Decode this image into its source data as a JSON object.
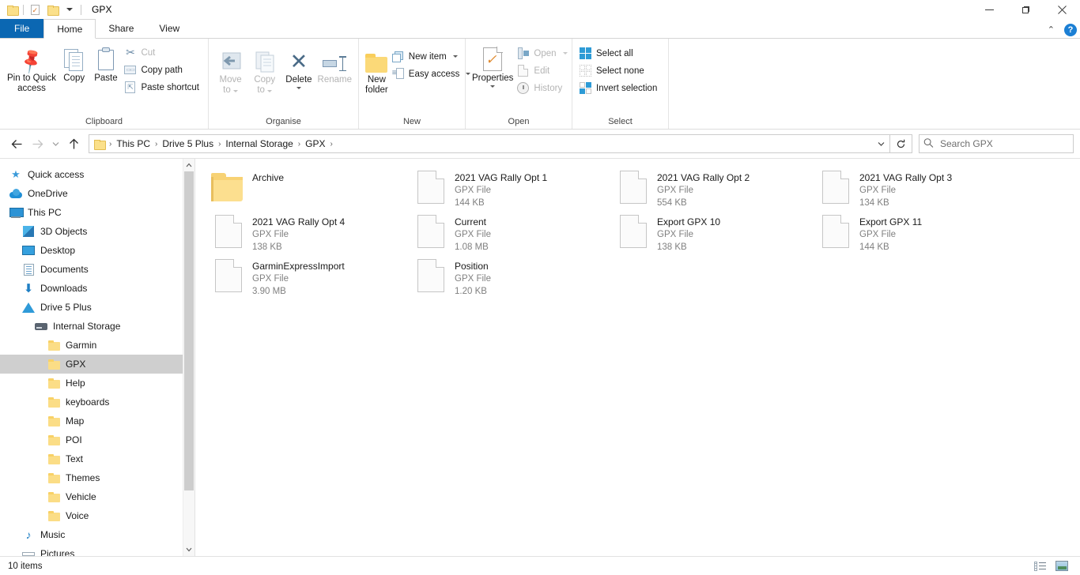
{
  "window": {
    "title": "GPX",
    "quick_access": [
      "folder-icon",
      "properties-icon",
      "new-folder-icon",
      "dropdown-arrow-icon"
    ],
    "controls": {
      "minimize": "—",
      "maximize": "❐",
      "close": "✕"
    }
  },
  "tabs": [
    {
      "id": "file",
      "label": "File"
    },
    {
      "id": "home",
      "label": "Home"
    },
    {
      "id": "share",
      "label": "Share"
    },
    {
      "id": "view",
      "label": "View"
    }
  ],
  "tab_right": {
    "collapse": "⌃",
    "help": "?"
  },
  "ribbon": {
    "groups": [
      {
        "name": "Clipboard",
        "label": "Clipboard",
        "big_buttons": [
          {
            "name": "pin-to-quick-access",
            "label": "Pin to Quick\naccess",
            "line1": "Pin to Quick",
            "line2": "access",
            "disabled": false
          },
          {
            "name": "copy",
            "label": "Copy",
            "line1": "Copy",
            "line2": "",
            "disabled": false
          },
          {
            "name": "paste",
            "label": "Paste",
            "line1": "Paste",
            "line2": "",
            "disabled": false
          }
        ],
        "small_buttons": [
          {
            "name": "cut",
            "label": "Cut",
            "disabled": true
          },
          {
            "name": "copy-path",
            "label": "Copy path",
            "disabled": false
          },
          {
            "name": "paste-shortcut",
            "label": "Paste shortcut",
            "disabled": false
          }
        ]
      },
      {
        "name": "Organise",
        "label": "Organise",
        "big_buttons": [
          {
            "name": "move-to",
            "line1": "Move",
            "line2": "to",
            "disabled": true,
            "caret": true
          },
          {
            "name": "copy-to",
            "line1": "Copy",
            "line2": "to",
            "disabled": true,
            "caret": true
          },
          {
            "name": "delete",
            "line1": "Delete",
            "line2": "",
            "disabled": false,
            "caret": true
          },
          {
            "name": "rename",
            "line1": "Rename",
            "line2": "",
            "disabled": true,
            "caret": false
          }
        ],
        "small_buttons": []
      },
      {
        "name": "New",
        "label": "New",
        "big_buttons": [
          {
            "name": "new-folder",
            "line1": "New",
            "line2": "folder",
            "disabled": false,
            "caret": false
          }
        ],
        "small_buttons": [
          {
            "name": "new-item",
            "label": "New item",
            "disabled": false,
            "caret": true
          },
          {
            "name": "easy-access",
            "label": "Easy access",
            "disabled": false,
            "caret": true
          }
        ]
      },
      {
        "name": "Open",
        "label": "Open",
        "big_buttons": [
          {
            "name": "properties",
            "line1": "Properties",
            "line2": "",
            "disabled": false,
            "caret": true
          }
        ],
        "small_buttons": [
          {
            "name": "open",
            "label": "Open",
            "disabled": true,
            "caret": true
          },
          {
            "name": "edit",
            "label": "Edit",
            "disabled": true
          },
          {
            "name": "history",
            "label": "History",
            "disabled": true
          }
        ]
      },
      {
        "name": "Select",
        "label": "Select",
        "big_buttons": [],
        "small_buttons": [
          {
            "name": "select-all",
            "label": "Select all",
            "disabled": false
          },
          {
            "name": "select-none",
            "label": "Select none",
            "disabled": false
          },
          {
            "name": "invert-selection",
            "label": "Invert selection",
            "disabled": false
          }
        ]
      }
    ]
  },
  "address_bar": {
    "back": "←",
    "forward": "→",
    "recent": "˅",
    "up": "↑",
    "breadcrumbs": [
      "This PC",
      "Drive 5 Plus",
      "Internal Storage",
      "GPX"
    ],
    "separator": "›",
    "dropdown": "˅",
    "refresh": "↻",
    "search_placeholder": "Search GPX",
    "search_value": ""
  },
  "nav_pane": {
    "items": [
      {
        "label": "Quick access",
        "icon": "star-icon",
        "indent": 0,
        "selected": false
      },
      {
        "label": "OneDrive",
        "icon": "cloud-icon",
        "indent": 0,
        "selected": false
      },
      {
        "label": "This PC",
        "icon": "computer-icon",
        "indent": 0,
        "selected": false
      },
      {
        "label": "3D Objects",
        "icon": "cube-icon",
        "indent": 1,
        "selected": false
      },
      {
        "label": "Desktop",
        "icon": "desktop-icon",
        "indent": 1,
        "selected": false
      },
      {
        "label": "Documents",
        "icon": "documents-icon",
        "indent": 1,
        "selected": false
      },
      {
        "label": "Downloads",
        "icon": "download-arrow-icon",
        "indent": 1,
        "selected": false
      },
      {
        "label": "Drive 5 Plus",
        "icon": "device-triangle-icon",
        "indent": 1,
        "selected": false
      },
      {
        "label": "Internal Storage",
        "icon": "hard-drive-icon",
        "indent": 2,
        "selected": false
      },
      {
        "label": "Garmin",
        "icon": "folder-icon",
        "indent": 3,
        "selected": false
      },
      {
        "label": "GPX",
        "icon": "folder-icon",
        "indent": 3,
        "selected": true
      },
      {
        "label": "Help",
        "icon": "folder-icon",
        "indent": 3,
        "selected": false
      },
      {
        "label": "keyboards",
        "icon": "folder-icon",
        "indent": 3,
        "selected": false
      },
      {
        "label": "Map",
        "icon": "folder-icon",
        "indent": 3,
        "selected": false
      },
      {
        "label": "POI",
        "icon": "folder-icon",
        "indent": 3,
        "selected": false
      },
      {
        "label": "Text",
        "icon": "folder-icon",
        "indent": 3,
        "selected": false
      },
      {
        "label": "Themes",
        "icon": "folder-icon",
        "indent": 3,
        "selected": false
      },
      {
        "label": "Vehicle",
        "icon": "folder-icon",
        "indent": 3,
        "selected": false
      },
      {
        "label": "Voice",
        "icon": "folder-icon",
        "indent": 3,
        "selected": false
      },
      {
        "label": "Music",
        "icon": "music-note-icon",
        "indent": 1,
        "selected": false
      },
      {
        "label": "Pictures",
        "icon": "picture-icon",
        "indent": 1,
        "selected": false
      }
    ]
  },
  "files": [
    {
      "name": "Archive",
      "type": "",
      "size": "",
      "kind": "folder"
    },
    {
      "name": "2021 VAG Rally Opt 1",
      "type": "GPX File",
      "size": "144 KB",
      "kind": "file"
    },
    {
      "name": "2021 VAG Rally Opt 2",
      "type": "GPX File",
      "size": "554 KB",
      "kind": "file"
    },
    {
      "name": "2021 VAG Rally Opt 3",
      "type": "GPX File",
      "size": "134 KB",
      "kind": "file"
    },
    {
      "name": "2021 VAG Rally Opt 4",
      "type": "GPX File",
      "size": "138 KB",
      "kind": "file"
    },
    {
      "name": "Current",
      "type": "GPX File",
      "size": "1.08 MB",
      "kind": "file"
    },
    {
      "name": "Export GPX 10",
      "type": "GPX File",
      "size": "138 KB",
      "kind": "file"
    },
    {
      "name": "Export GPX 11",
      "type": "GPX File",
      "size": "144 KB",
      "kind": "file"
    },
    {
      "name": "GarminExpressImport",
      "type": "GPX File",
      "size": "3.90 MB",
      "kind": "file"
    },
    {
      "name": "Position",
      "type": "GPX File",
      "size": "1.20 KB",
      "kind": "file"
    }
  ],
  "status_bar": {
    "item_count": "10 items",
    "views": [
      {
        "name": "details-view",
        "active": false
      },
      {
        "name": "large-icons-view",
        "active": false
      }
    ]
  },
  "colors": {
    "accent": "#0b67b2",
    "selection": "#cfcfcf",
    "hover": "#e5f3fb",
    "folder_yellow": "#fcdf8f",
    "meta_gray": "#808080"
  }
}
